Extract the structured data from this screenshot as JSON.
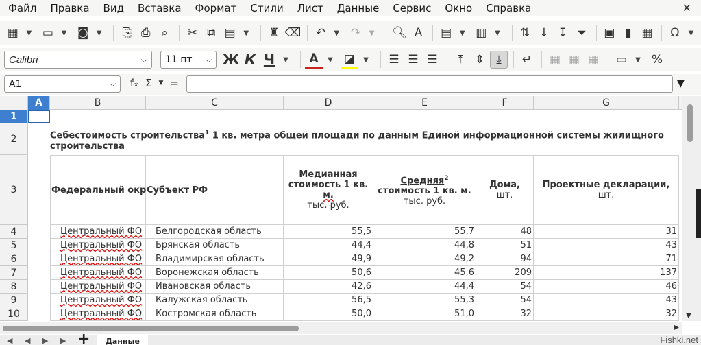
{
  "menu": [
    "Файл",
    "Правка",
    "Вид",
    "Вставка",
    "Формат",
    "Стили",
    "Лист",
    "Данные",
    "Сервис",
    "Окно",
    "Справка"
  ],
  "toolbar": {
    "font_name": "Calibri",
    "font_size": "11 пт",
    "bold_label": "Ж",
    "italic_label": "К",
    "underline_label": "Ч",
    "percent_label": "%"
  },
  "formula_bar": {
    "name_box": "A1",
    "fx_label": "fₓ",
    "sum_label": "Σ",
    "eq_label": "=",
    "content": ""
  },
  "columns": [
    "A",
    "B",
    "C",
    "D",
    "E",
    "F",
    "G"
  ],
  "rows": [
    "1",
    "2",
    "3",
    "4",
    "5",
    "6",
    "7",
    "8",
    "9",
    "10"
  ],
  "sheet": {
    "title": "Себестоимость строительства",
    "title_sup": "1",
    "title_rest": " 1 кв. метра общей площади по данным Единой информационной системы жилищного строительства",
    "headers": {
      "b": "Федеральный окр",
      "c": "Субъект РФ",
      "d_line1": "Медианная ",
      "d_line2": "стоимость 1 кв.",
      "d_line3": "м.",
      "d_unit": "тыс. руб.",
      "e_line1": "Средняя",
      "e_sup": "2",
      "e_line2": "стоимость 1 кв. м.",
      "e_unit": "тыс. руб.",
      "f_line1": "Дома,",
      "f_unit": "шт.",
      "g_line1": "Проектные декларации,",
      "g_unit": "шт."
    },
    "data_rows": [
      {
        "district": "Центральный ФО",
        "region": "Белгородская область",
        "median": "55,5",
        "avg": "55,7",
        "houses": "48",
        "decl": "31"
      },
      {
        "district": "Центральный ФО",
        "region": "Брянская область",
        "median": "44,4",
        "avg": "44,8",
        "houses": "51",
        "decl": "43"
      },
      {
        "district": "Центральный ФО",
        "region": "Владимирская область",
        "median": "49,9",
        "avg": "49,2",
        "houses": "94",
        "decl": "71"
      },
      {
        "district": "Центральный ФО",
        "region": "Воронежская область",
        "median": "50,6",
        "avg": "45,6",
        "houses": "209",
        "decl": "137"
      },
      {
        "district": "Центральный ФО",
        "region": "Ивановская область",
        "median": "42,6",
        "avg": "44,4",
        "houses": "54",
        "decl": "46"
      },
      {
        "district": "Центральный ФО",
        "region": "Калужская область",
        "median": "56,5",
        "avg": "55,3",
        "houses": "54",
        "decl": "43"
      },
      {
        "district": "Центральный ФО",
        "region": "Костромская область",
        "median": "50,0",
        "avg": "51,0",
        "houses": "32",
        "decl": "32"
      }
    ]
  },
  "sheet_tab": "Данные",
  "watermark": "Fishki.net"
}
